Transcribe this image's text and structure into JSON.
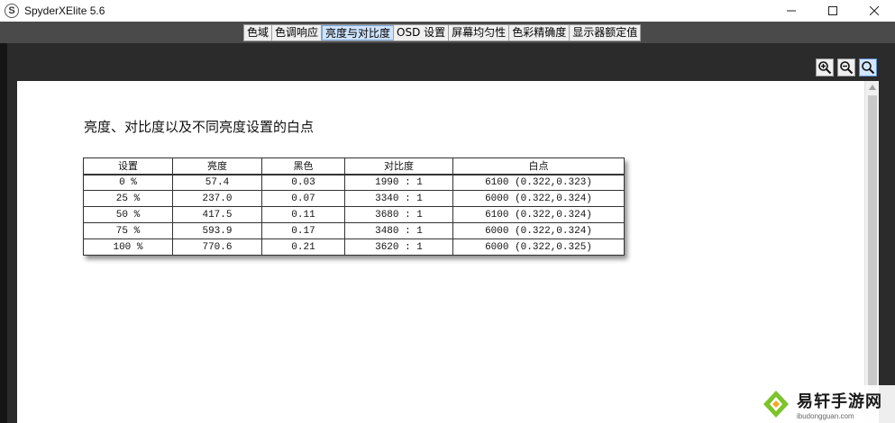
{
  "window": {
    "title": "SpyderXElite 5.6",
    "logo_letter": "S",
    "controls": [
      "minimize-icon",
      "maximize-icon",
      "close-icon"
    ]
  },
  "tabs": [
    {
      "label": "色域",
      "active": false
    },
    {
      "label": "色调响应",
      "active": false
    },
    {
      "label": "亮度与对比度",
      "active": true
    },
    {
      "label": "OSD 设置",
      "active": false
    },
    {
      "label": "屏幕均匀性",
      "active": false
    },
    {
      "label": "色彩精确度",
      "active": false
    },
    {
      "label": "显示器额定值",
      "active": false
    }
  ],
  "zoom_tools": [
    "zoom-in-icon",
    "zoom-out-icon",
    "zoom-fit-icon"
  ],
  "document": {
    "heading": "亮度、对比度以及不同亮度设置的白点",
    "table": {
      "headers": [
        "设置",
        "亮度",
        "黑色",
        "对比度",
        "白点"
      ],
      "rows": [
        [
          "0 %",
          "57.4",
          "0.03",
          "1990 : 1",
          "6100 (0.322,0.323)"
        ],
        [
          "25 %",
          "237.0",
          "0.07",
          "3340 : 1",
          "6000 (0.322,0.324)"
        ],
        [
          "50 %",
          "417.5",
          "0.11",
          "3680 : 1",
          "6100 (0.322,0.324)"
        ],
        [
          "75 %",
          "593.9",
          "0.17",
          "3480 : 1",
          "6000 (0.322,0.324)"
        ],
        [
          "100 %",
          "770.6",
          "0.21",
          "3620 : 1",
          "6000 (0.322,0.325)"
        ]
      ]
    }
  },
  "watermark": {
    "name": "易轩手游网",
    "domain": "ibudongguan.com"
  },
  "colors": {
    "active_tab": "#cfe3fb",
    "workspace": "#2b2b2b",
    "watermark_green": "#7cc42a",
    "watermark_orange": "#f5a623"
  }
}
